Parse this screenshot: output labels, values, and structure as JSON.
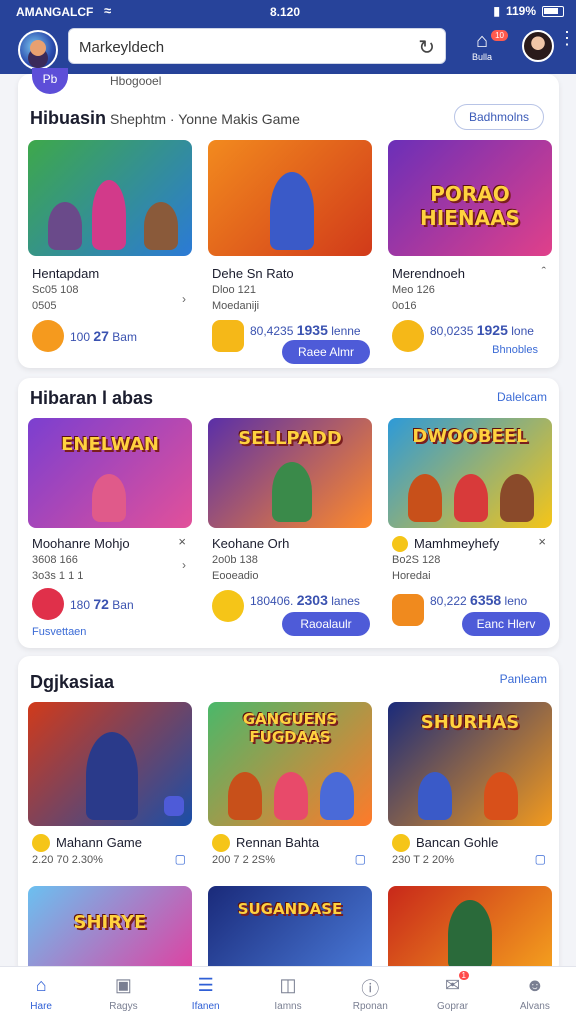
{
  "status_bar": {
    "carrier": "AMANGALCF",
    "time": "8.120",
    "battery": "119%"
  },
  "header": {
    "search_value": "Markeyldech",
    "home_label": "Bulla",
    "home_badge": "10"
  },
  "section1": {
    "prev_row_text": "Hbogooel",
    "prev_badge": "Pb",
    "title": "Hibuasin",
    "subtitle": "Shephtm · Yonne Makis  Game",
    "link": "Badhmolns",
    "cards": [
      {
        "name": "Hentapdam",
        "meta1": "Sc05  108",
        "meta2": "0505",
        "price_prefix": "100",
        "price_main": "27",
        "price_suffix": "Bam",
        "art_text": "",
        "colors": [
          "#3ea84a",
          "#2b7ad6"
        ]
      },
      {
        "name": "Dehe Sn Rato",
        "meta1": "Dloo  121",
        "meta2": "Moedaniji",
        "price_prefix": "80,4235",
        "price_main": "1935",
        "price_suffix": "lenne",
        "button": "Raee Almr",
        "art_text": "",
        "colors": [
          "#f28a1e",
          "#d13a1a"
        ]
      },
      {
        "name": "Merendnoeh",
        "meta1": "Meo  126",
        "meta2": "0o16",
        "price_prefix": "80,0235",
        "price_main": "1925",
        "price_suffix": "lone",
        "link": "Bhnobles",
        "art_text": "PORAO HIENAAS",
        "colors": [
          "#6b2fb8",
          "#e0408a"
        ]
      }
    ]
  },
  "section2": {
    "title": "Hibaran l abas",
    "link": "Dalelcam",
    "cards": [
      {
        "name": "Moohanre Mohjo",
        "meta1": "3608  166",
        "meta2": "3o3s  1 1 1",
        "price_prefix": "180",
        "price_main": "72",
        "price_suffix": "Ban",
        "link": "Fusvettaen",
        "art_text": "ENELWAN",
        "colors": [
          "#7b3fd0",
          "#e2509a"
        ]
      },
      {
        "name": "Keohane Orh",
        "meta1": "2o0b  138",
        "meta2": "Eooeadio",
        "price_prefix": "180406.",
        "price_main": "2303",
        "price_suffix": "lanes",
        "button": "Raoalaulr",
        "art_text": "SELLPADD",
        "colors": [
          "#5a2fa8",
          "#ff8a2a"
        ]
      },
      {
        "name": "Mamhmeyhefy",
        "meta1": "Bo2S  128",
        "meta2": "Horedai",
        "price_prefix": "80,222",
        "price_main": "6358",
        "price_suffix": "leno",
        "button": "Eanc Hlerv",
        "art_text": "DWOOBEEL",
        "colors": [
          "#2d9ad8",
          "#f5c518"
        ]
      }
    ]
  },
  "section3": {
    "title": "Dgjkasiaa",
    "link": "Panleam",
    "cards": [
      {
        "name": "Mahann Game",
        "meta": "2.20  70 2.30%",
        "art_text": "",
        "colors": [
          "#d13a1a",
          "#1a4ea8"
        ]
      },
      {
        "name": "Rennan Bahta",
        "meta": "200  7 2 2S%",
        "art_text": "GANGUENS FUGDAAS",
        "colors": [
          "#4ab86a",
          "#ff7a2a"
        ]
      },
      {
        "name": "Bancan Gohle",
        "meta": "230  T 2 20%",
        "art_text": "SHURHAS",
        "colors": [
          "#1a2a7a",
          "#f29a1e"
        ]
      }
    ],
    "peek_cards": [
      {
        "art_text": "SHIRYE",
        "colors": [
          "#6bc0f0",
          "#e040a0"
        ]
      },
      {
        "art_text": "SUGANDASE",
        "colors": [
          "#1a2a7a",
          "#4a7ad8"
        ]
      },
      {
        "art_text": "",
        "colors": [
          "#c8281a",
          "#f5a21e"
        ]
      }
    ]
  },
  "bottom_nav": [
    {
      "label": "Hare",
      "icon": "home-icon",
      "active": true
    },
    {
      "label": "Ragys",
      "icon": "image-icon",
      "active": false
    },
    {
      "label": "Ifanen",
      "icon": "list-icon",
      "active": true
    },
    {
      "label": "Iamns",
      "icon": "folder-icon",
      "active": false
    },
    {
      "label": "Rponan",
      "icon": "info-icon",
      "active": false
    },
    {
      "label": "Goprar",
      "icon": "mail-icon",
      "badge": "1",
      "active": false
    },
    {
      "label": "Alvans",
      "icon": "person-icon",
      "active": false
    }
  ],
  "colors": {
    "header_bg": "#27439a",
    "accent": "#4e5bd8",
    "link": "#3b6bd6"
  }
}
